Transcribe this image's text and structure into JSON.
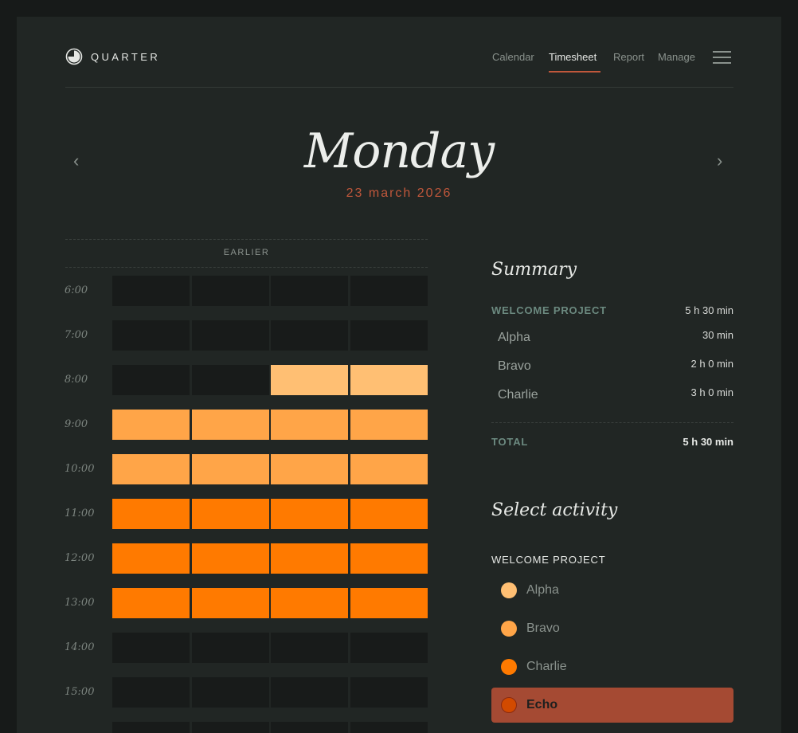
{
  "header": {
    "app_name": "QUARTER",
    "nav": [
      {
        "label": "Calendar",
        "active": false
      },
      {
        "label": "Timesheet",
        "active": true
      },
      {
        "label": "Report",
        "active": false
      },
      {
        "label": "Manage",
        "active": false
      }
    ],
    "menu_icon": "hamburger-icon"
  },
  "day": {
    "title": "Monday",
    "date": "23 march 2026",
    "prev_icon": "chevron-left-icon",
    "next_icon": "chevron-right-icon"
  },
  "timeline": {
    "earlier_label": "EARLIER",
    "hours": [
      {
        "label": "6:00",
        "slots": [
          "empty",
          "empty",
          "empty",
          "empty"
        ]
      },
      {
        "label": "7:00",
        "slots": [
          "empty",
          "empty",
          "empty",
          "empty"
        ]
      },
      {
        "label": "8:00",
        "slots": [
          "empty",
          "empty",
          "Alpha",
          "Alpha"
        ]
      },
      {
        "label": "9:00",
        "slots": [
          "Bravo",
          "Bravo",
          "Bravo",
          "Bravo"
        ]
      },
      {
        "label": "10:00",
        "slots": [
          "Bravo",
          "Bravo",
          "Bravo",
          "Bravo"
        ]
      },
      {
        "label": "11:00",
        "slots": [
          "Charlie",
          "Charlie",
          "Charlie",
          "Charlie"
        ]
      },
      {
        "label": "12:00",
        "slots": [
          "Charlie",
          "Charlie",
          "Charlie",
          "Charlie"
        ]
      },
      {
        "label": "13:00",
        "slots": [
          "Charlie",
          "Charlie",
          "Charlie",
          "Charlie"
        ]
      },
      {
        "label": "14:00",
        "slots": [
          "empty",
          "empty",
          "empty",
          "empty"
        ]
      },
      {
        "label": "15:00",
        "slots": [
          "empty",
          "empty",
          "empty",
          "empty"
        ]
      },
      {
        "label": "",
        "slots": [
          "empty",
          "empty",
          "empty",
          "empty"
        ]
      }
    ]
  },
  "summary": {
    "title": "Summary",
    "project": {
      "name": "WELCOME PROJECT",
      "total": "5 h 30 min"
    },
    "items": [
      {
        "name": "Alpha",
        "value": "30 min"
      },
      {
        "name": "Bravo",
        "value": "2 h 0 min"
      },
      {
        "name": "Charlie",
        "value": "3 h 0 min"
      }
    ],
    "total_label": "TOTAL",
    "total_value": "5 h 30 min"
  },
  "activity": {
    "title": "Select activity",
    "project": "WELCOME PROJECT",
    "items": [
      {
        "name": "Alpha",
        "selected": false
      },
      {
        "name": "Bravo",
        "selected": false
      },
      {
        "name": "Charlie",
        "selected": false
      },
      {
        "name": "Echo",
        "selected": true
      }
    ]
  },
  "colors": {
    "empty": "#181b1a",
    "Alpha": "#ffbf73",
    "Bravo": "#ffa548",
    "Charlie": "#ff7a00",
    "Echo": "#d24a00",
    "accent": "#c0573b"
  }
}
